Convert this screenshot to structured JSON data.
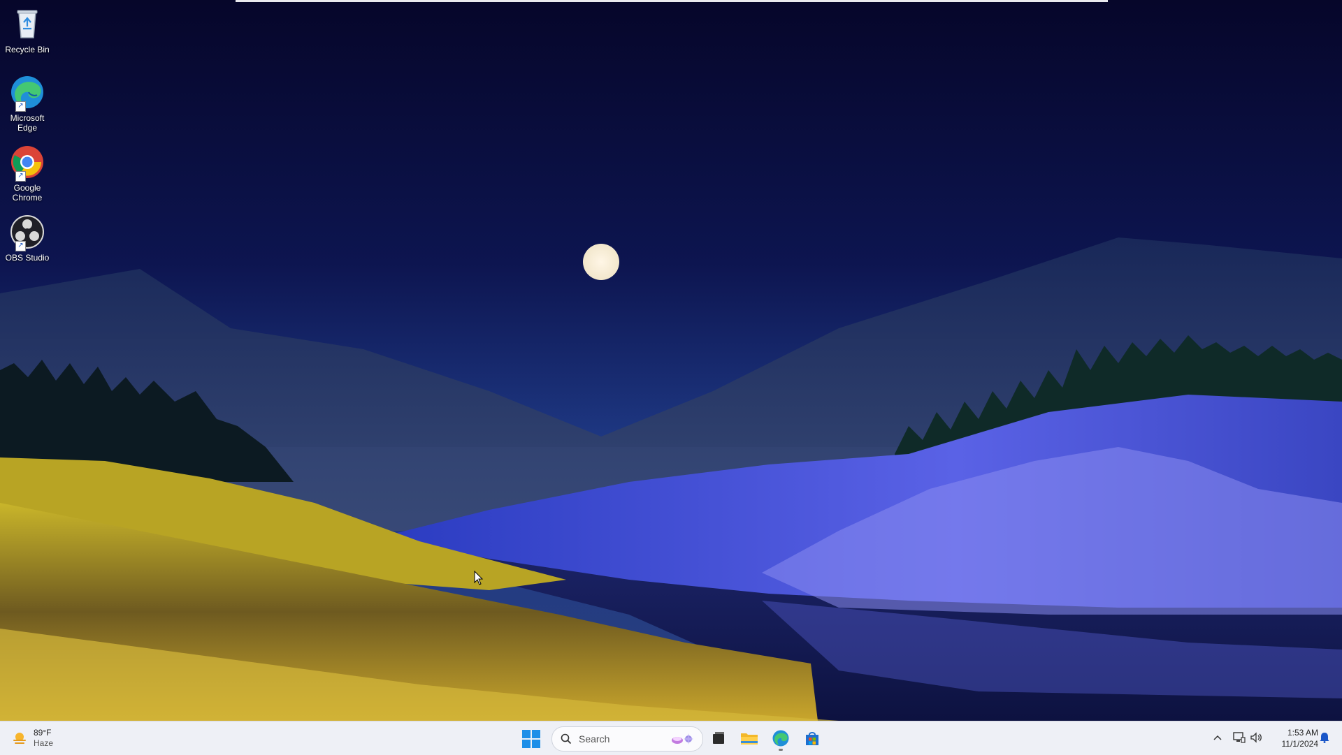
{
  "desktop": {
    "icons": [
      {
        "id": "recycle-bin",
        "label": "Recycle Bin",
        "icon": "recycle-bin-icon"
      },
      {
        "id": "edge",
        "label": "Microsoft Edge",
        "icon": "edge-icon"
      },
      {
        "id": "chrome",
        "label": "Google Chrome",
        "icon": "chrome-icon"
      },
      {
        "id": "obs",
        "label": "OBS Studio",
        "icon": "obs-icon"
      }
    ]
  },
  "taskbar": {
    "weather": {
      "temperature": "89°F",
      "condition": "Haze",
      "icon": "sun-haze-icon"
    },
    "start_icon": "windows-start-icon",
    "search": {
      "placeholder": "Search"
    },
    "pinned": [
      {
        "id": "task-view",
        "icon": "task-view-icon"
      },
      {
        "id": "file-explorer",
        "icon": "folder-icon"
      },
      {
        "id": "edge",
        "icon": "edge-icon",
        "active": true
      },
      {
        "id": "store",
        "icon": "store-icon"
      }
    ],
    "tray": {
      "chevron": "chevron-up-icon",
      "network": "network-icon",
      "volume": "volume-icon",
      "notifications": "bell-icon"
    },
    "clock": {
      "time": "1:53 AM",
      "date": "11/1/2024"
    }
  },
  "colors": {
    "sky_top": "#07072a",
    "taskbar": "#eef0f6",
    "accent": "#1e8fe8"
  }
}
